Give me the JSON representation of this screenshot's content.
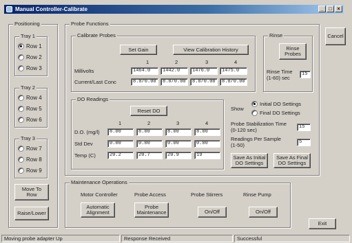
{
  "window": {
    "title": "Manual Controller-Calibrate",
    "controls": [
      "_",
      "□",
      "×"
    ]
  },
  "positioning": {
    "label": "Positioning",
    "trays": [
      {
        "label": "Tray 1",
        "rows": [
          "Row 1",
          "Row 2",
          "Row 3"
        ],
        "selected": 0
      },
      {
        "label": "Tray 2",
        "rows": [
          "Row 4",
          "Row 5",
          "Row 6"
        ],
        "selected": -1
      },
      {
        "label": "Tray 3",
        "rows": [
          "Row 7",
          "Row 8",
          "Row 9"
        ],
        "selected": -1
      }
    ],
    "move_button": "Move To\nRow",
    "raise_button": "Raise/Lower"
  },
  "probe_functions": {
    "label": "Probe Functions",
    "calibrate": {
      "label": "Calibrate Probes",
      "set_gain": "Set Gain",
      "view_history": "View Calibration History",
      "columns": [
        "1",
        "2",
        "3",
        "4"
      ],
      "millivolts_label": "Millivolts",
      "millivolts": [
        "1464.0",
        "1442.0",
        "1476.0",
        "1475.0"
      ],
      "current_label": "Current/Last Conc",
      "current": [
        "8.0/0.00",
        "8.0/0.00",
        "8.0/0.00",
        "8.0/0.00"
      ]
    },
    "rinse": {
      "label": "Rinse",
      "button": "Rinse\nProbes",
      "time_label": "Rinse Time\n(1-60) sec",
      "time_value": "15"
    },
    "do_readings": {
      "label": "DO Readings",
      "reset": "Reset DO",
      "columns": [
        "1",
        "2",
        "3",
        "4"
      ],
      "rows": [
        {
          "label": "D.O. (mg/l)",
          "values": [
            "8.00",
            "8.00",
            "8.00",
            "8.00"
          ]
        },
        {
          "label": "Std Dev",
          "values": [
            "0.00",
            "0.00",
            "0.00",
            "0.00"
          ]
        },
        {
          "label": "Temp (C)",
          "values": [
            "20.2",
            "20.7",
            "20.9",
            "19"
          ]
        }
      ]
    },
    "show": {
      "label": "Show",
      "options": [
        "Initial DO Settings",
        "Final DO Settings"
      ],
      "selected": 0
    },
    "stabilization": {
      "label": "Probe Stabilization Time\n(0-120 sec)",
      "value": "15"
    },
    "readings_per_sample": {
      "label": "Readings Per Sample\n(1-50)",
      "value": "5"
    },
    "save_initial": "Save As Initial\nDO Settings",
    "save_final": "Save As Final\nDO Settings"
  },
  "maintenance": {
    "label": "Maintenance Operations",
    "motor": {
      "label": "Motor Controller",
      "button": "Automatic\nAlignment"
    },
    "access": {
      "label": "Probe Access",
      "button": "Probe\nMaintenance"
    },
    "stirrers": {
      "label": "Probe Stirrers",
      "button": "On/Off"
    },
    "rinse_pump": {
      "label": "Rinse Pump",
      "button": "On/Off"
    }
  },
  "cancel_button": "Cancel",
  "exit_button": "Exit",
  "statusbar": [
    "Moving probe adapter Up",
    "Response Received",
    "Successful"
  ]
}
